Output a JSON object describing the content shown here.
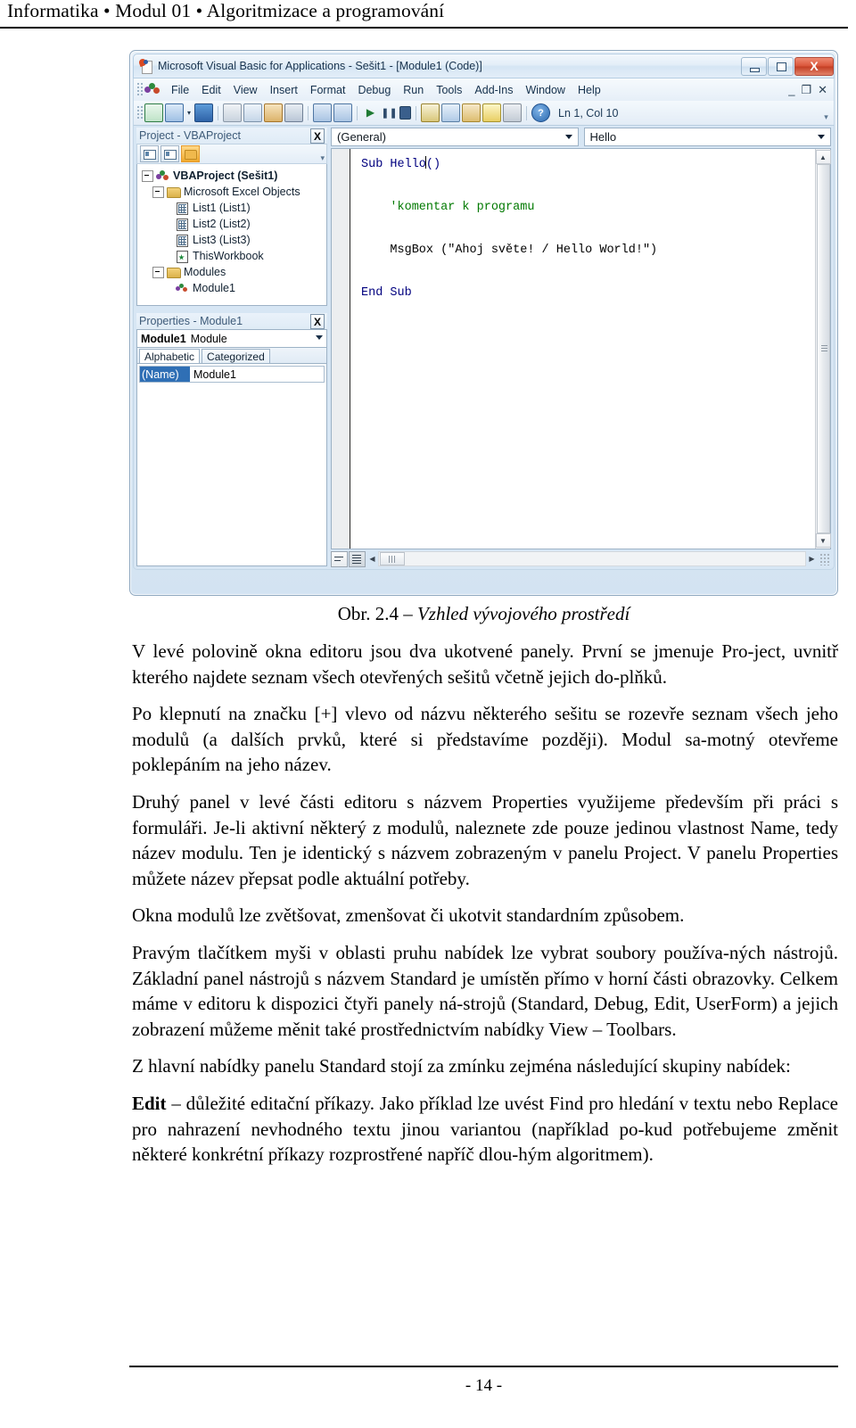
{
  "running_head": "Informatika • Modul 01 • Algoritmizace a programování",
  "vbe": {
    "title": "Microsoft Visual Basic for Applications - Sešit1 - [Module1 (Code)]",
    "window_buttons": {
      "minimize": "minimize-icon",
      "maximize": "maximize-icon",
      "close": "X"
    },
    "mdi_buttons": {
      "minimize": "_",
      "restore": "❐",
      "close": "✕"
    },
    "menu": [
      {
        "label": "File",
        "accel": "F"
      },
      {
        "label": "Edit",
        "accel": "E"
      },
      {
        "label": "View",
        "accel": "V"
      },
      {
        "label": "Insert",
        "accel": "I"
      },
      {
        "label": "Format",
        "accel": "o"
      },
      {
        "label": "Debug",
        "accel": "D"
      },
      {
        "label": "Run",
        "accel": "R"
      },
      {
        "label": "Tools",
        "accel": "T"
      },
      {
        "label": "Add-Ins",
        "accel": "A"
      },
      {
        "label": "Window",
        "accel": "W"
      },
      {
        "label": "Help",
        "accel": "H"
      }
    ],
    "toolbar": {
      "icons": [
        "excel-view-icon",
        "insert-userform-icon",
        "save-icon",
        "cut-icon",
        "copy-icon",
        "paste-icon",
        "find-icon",
        "undo-icon",
        "redo-icon",
        "run-icon",
        "break-icon",
        "reset-icon",
        "design-mode-icon",
        "project-explorer-icon",
        "properties-window-icon",
        "object-browser-icon",
        "toolbox-icon",
        "help-icon"
      ],
      "position_indicator": "Ln 1, Col 10"
    },
    "project_panel": {
      "caption": "Project - VBAProject",
      "close_label": "X",
      "toolbar_buttons": [
        "view-code-icon",
        "view-object-icon",
        "toggle-folders-icon"
      ],
      "tree": [
        {
          "label": "VBAProject (Sešit1)",
          "icon": "vbproject-icon",
          "level": 0,
          "expanded": true,
          "bold": true
        },
        {
          "label": "Microsoft Excel Objects",
          "icon": "folder-icon",
          "level": 1,
          "expanded": true,
          "bold": false
        },
        {
          "label": "List1 (List1)",
          "icon": "worksheet-icon",
          "level": 2,
          "expanded": false,
          "bold": false
        },
        {
          "label": "List2 (List2)",
          "icon": "worksheet-icon",
          "level": 2,
          "expanded": false,
          "bold": false
        },
        {
          "label": "List3 (List3)",
          "icon": "worksheet-icon",
          "level": 2,
          "expanded": false,
          "bold": false
        },
        {
          "label": "ThisWorkbook",
          "icon": "workbook-icon",
          "level": 2,
          "expanded": false,
          "bold": false
        },
        {
          "label": "Modules",
          "icon": "folder-icon",
          "level": 1,
          "expanded": true,
          "bold": false
        },
        {
          "label": "Module1",
          "icon": "module-icon",
          "level": 2,
          "expanded": false,
          "bold": false
        }
      ]
    },
    "properties_panel": {
      "caption": "Properties - Module1",
      "close_label": "X",
      "object_selector": {
        "name": "Module1",
        "type": "Module"
      },
      "tabs": [
        {
          "label": "Alphabetic",
          "active": true
        },
        {
          "label": "Categorized",
          "active": false
        }
      ],
      "rows": [
        {
          "key": "(Name)",
          "value": "Module1"
        }
      ]
    },
    "code_window": {
      "object_combo": "(General)",
      "procedure_combo": "Hello",
      "lines": [
        {
          "text": "Sub Hello",
          "kind": "keyword-start",
          "caret_after": true,
          "tail": "()"
        },
        {
          "text": "",
          "kind": "blank"
        },
        {
          "text": "    'komentar k programu",
          "kind": "comment"
        },
        {
          "text": "",
          "kind": "blank"
        },
        {
          "text": "    MsgBox (\"Ahoj světe! / Hello World!\")",
          "kind": "code"
        },
        {
          "text": "",
          "kind": "blank"
        },
        {
          "text": "End Sub",
          "kind": "keyword"
        }
      ],
      "view_buttons": [
        "procedure-view-icon",
        "full-module-view-icon"
      ]
    }
  },
  "figure": {
    "number": "Obr. 2.4 – ",
    "title": "Vzhled vývojového prostředí"
  },
  "paragraphs": [
    "V levé polovině okna editoru jsou dva ukotvené panely. První se jmenuje Pro-ject, uvnitř kterého najdete seznam všech otevřených sešitů včetně jejich do-plňků.",
    "Po klepnutí na značku [+] vlevo od názvu některého sešitu se rozevře seznam všech jeho modulů (a dalších prvků, které si představíme později). Modul sa-motný otevřeme poklepáním na jeho název.",
    "Druhý panel v levé části editoru s názvem Properties využijeme především při práci s formuláři. Je-li aktivní některý z modulů, naleznete zde pouze jedinou vlastnost Name, tedy název modulu. Ten je identický s názvem zobrazeným v panelu Project. V panelu Properties můžete název přepsat podle aktuální potřeby.",
    "Okna modulů lze zvětšovat, zmenšovat či ukotvit standardním způsobem.",
    "Pravým tlačítkem myši v oblasti pruhu nabídek lze vybrat soubory používa-ných nástrojů. Základní panel nástrojů s názvem Standard je umístěn přímo v horní části obrazovky. Celkem máme v editoru k dispozici čtyři panely ná-strojů (Standard, Debug, Edit, UserForm) a jejich zobrazení můžeme měnit také prostřednictvím nabídky View – Toolbars.",
    "Z hlavní nabídky panelu Standard stojí za zmínku zejména následující skupiny nabídek:"
  ],
  "last_paragraph": {
    "lead": "Edit",
    "rest": " – důležité editační příkazy. Jako příklad lze uvést Find pro hledání v textu nebo Replace pro nahrazení nevhodného textu jinou variantou (například po-kud potřebujeme změnit některé konkrétní příkazy rozprostřené napříč dlou-hým algoritmem)."
  },
  "page_number": "- 14 -"
}
